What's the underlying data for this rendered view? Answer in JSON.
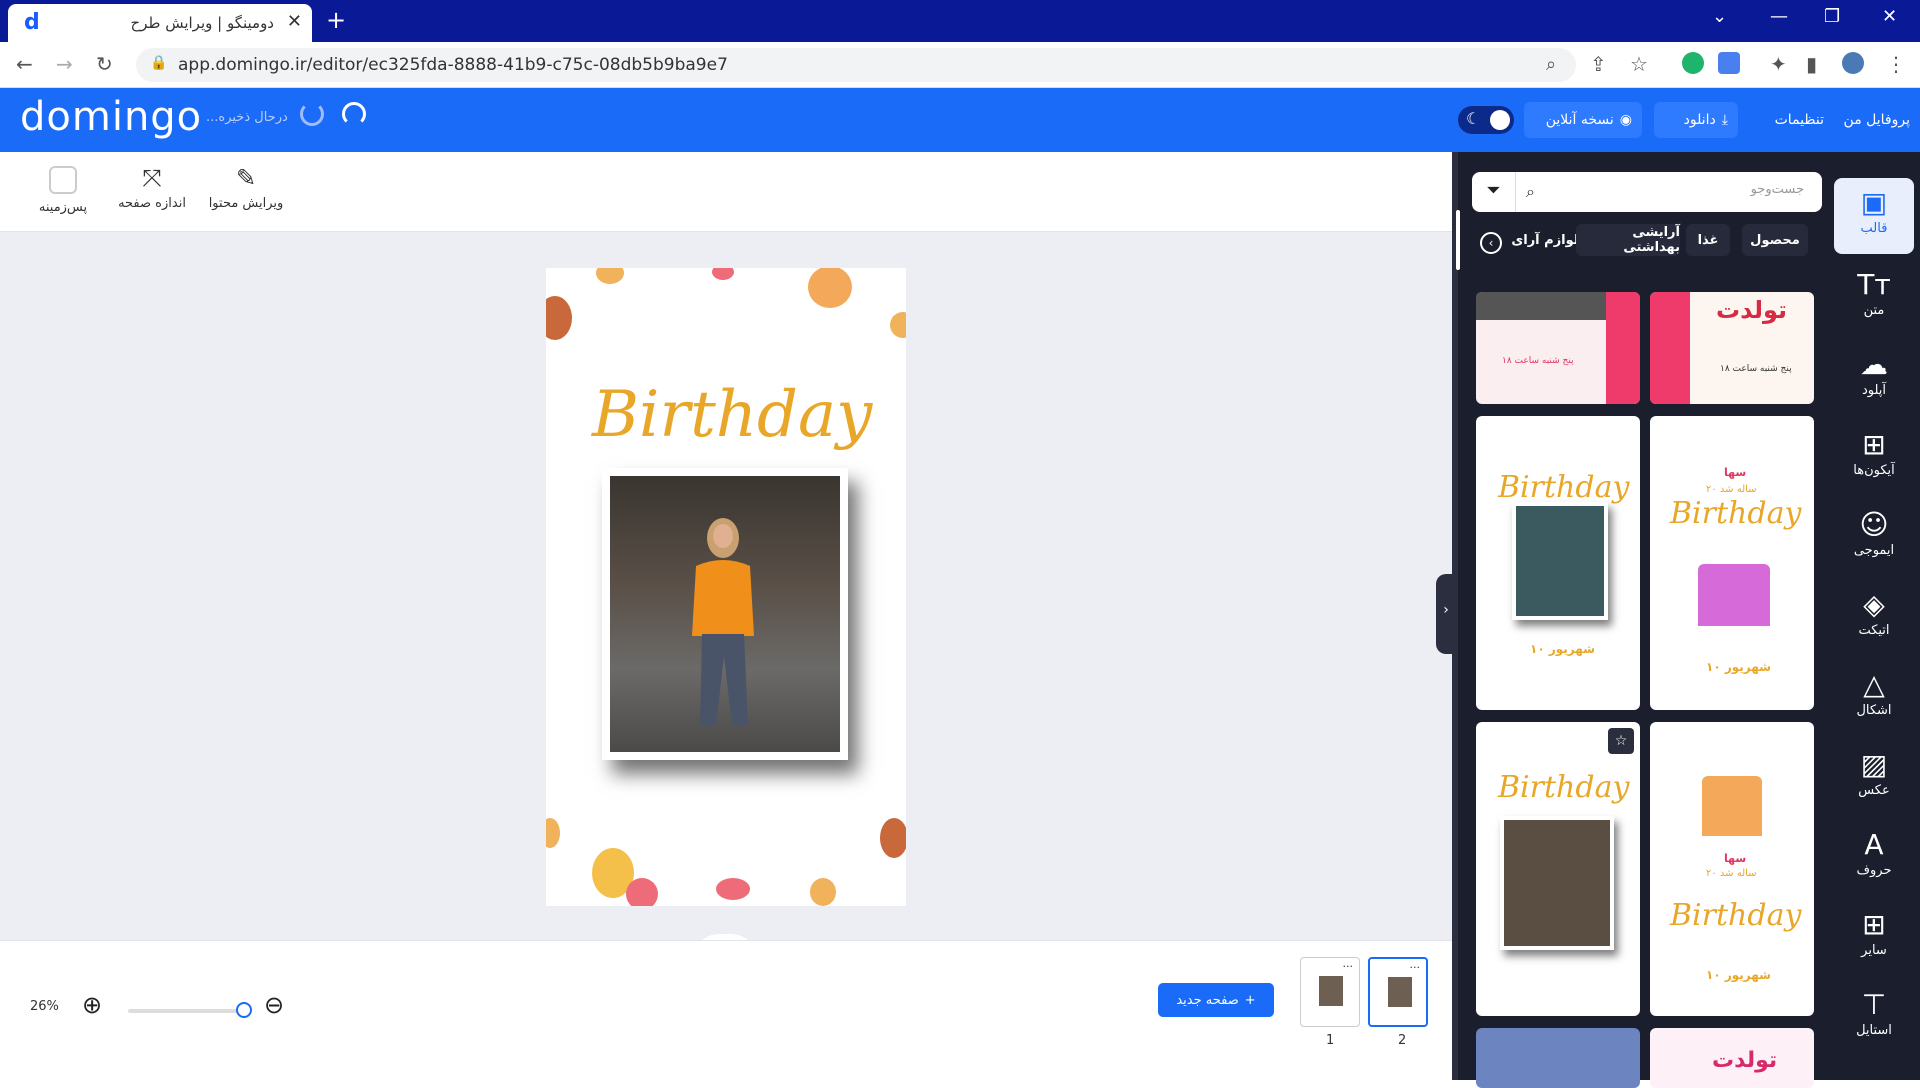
{
  "browser": {
    "tab_title": "دومینگو | ویرایش طرح",
    "tab_favicon": "d",
    "new_tab": "+",
    "url": "app.domingo.ir/editor/ec325fda-8888-41b9-c75c-08db5b9ba9e7"
  },
  "app": {
    "logo": "domingo",
    "saving_status": "درحال ذخیره...",
    "profile_label": "پروفایل من",
    "settings_label": "تنظیمات",
    "download_label": "دانلود",
    "online_label": "نسخه آنلاین"
  },
  "toolbar": {
    "background_label": "پس‌زمینه",
    "page_size_label": "اندازه صفحه",
    "edit_content_label": "ویرایش محتوا"
  },
  "canvas": {
    "heading": "Birthday"
  },
  "bottom": {
    "zoom": "26%",
    "new_page_label": "صفحه جدید",
    "pages": [
      "1",
      "2"
    ],
    "selected_page": "2"
  },
  "panel": {
    "search_placeholder": "جست‌وجو",
    "chips": [
      "محصول",
      "غذا",
      "آرایشی بهداشتی",
      "لوازم آرای"
    ],
    "templates": [
      {
        "title": "تولدت",
        "text": "پنج شنبه ساعت ۱۸"
      },
      {
        "title": "",
        "text": "پنج شنبه ساعت ۱۸"
      },
      {
        "title": "Birthday",
        "text": "۱۰ شهریور"
      },
      {
        "title": "Birthday",
        "text": "۱۰ شهریور",
        "subtitle": "سها",
        "age": "۲۰ ساله شد"
      },
      {
        "title": "Birthday",
        "text": ""
      },
      {
        "title": "Birthday",
        "text": "۱۰ شهریور",
        "subtitle": "سها",
        "age": "۲۰ ساله شد"
      },
      {
        "title": "",
        "text": ""
      },
      {
        "title": "تولدت",
        "text": ""
      }
    ]
  },
  "rail": [
    {
      "label": "قالب",
      "icon": "template-icon"
    },
    {
      "label": "متن",
      "icon": "text-icon"
    },
    {
      "label": "آپلود",
      "icon": "upload-icon"
    },
    {
      "label": "آیکون‌ها",
      "icon": "icons-icon"
    },
    {
      "label": "ایموجی",
      "icon": "emoji-icon"
    },
    {
      "label": "اتیکت",
      "icon": "tag-icon"
    },
    {
      "label": "اشکال",
      "icon": "shapes-icon"
    },
    {
      "label": "عکس",
      "icon": "image-icon"
    },
    {
      "label": "حروف",
      "icon": "letters-icon"
    },
    {
      "label": "سایر",
      "icon": "more-icon"
    },
    {
      "label": "استایل",
      "icon": "style-icon"
    }
  ],
  "colors": {
    "brand": "#1a6bf7",
    "browser_frame": "#0a1a96",
    "panel": "#1b1e2c",
    "gold": "#e8a728"
  }
}
